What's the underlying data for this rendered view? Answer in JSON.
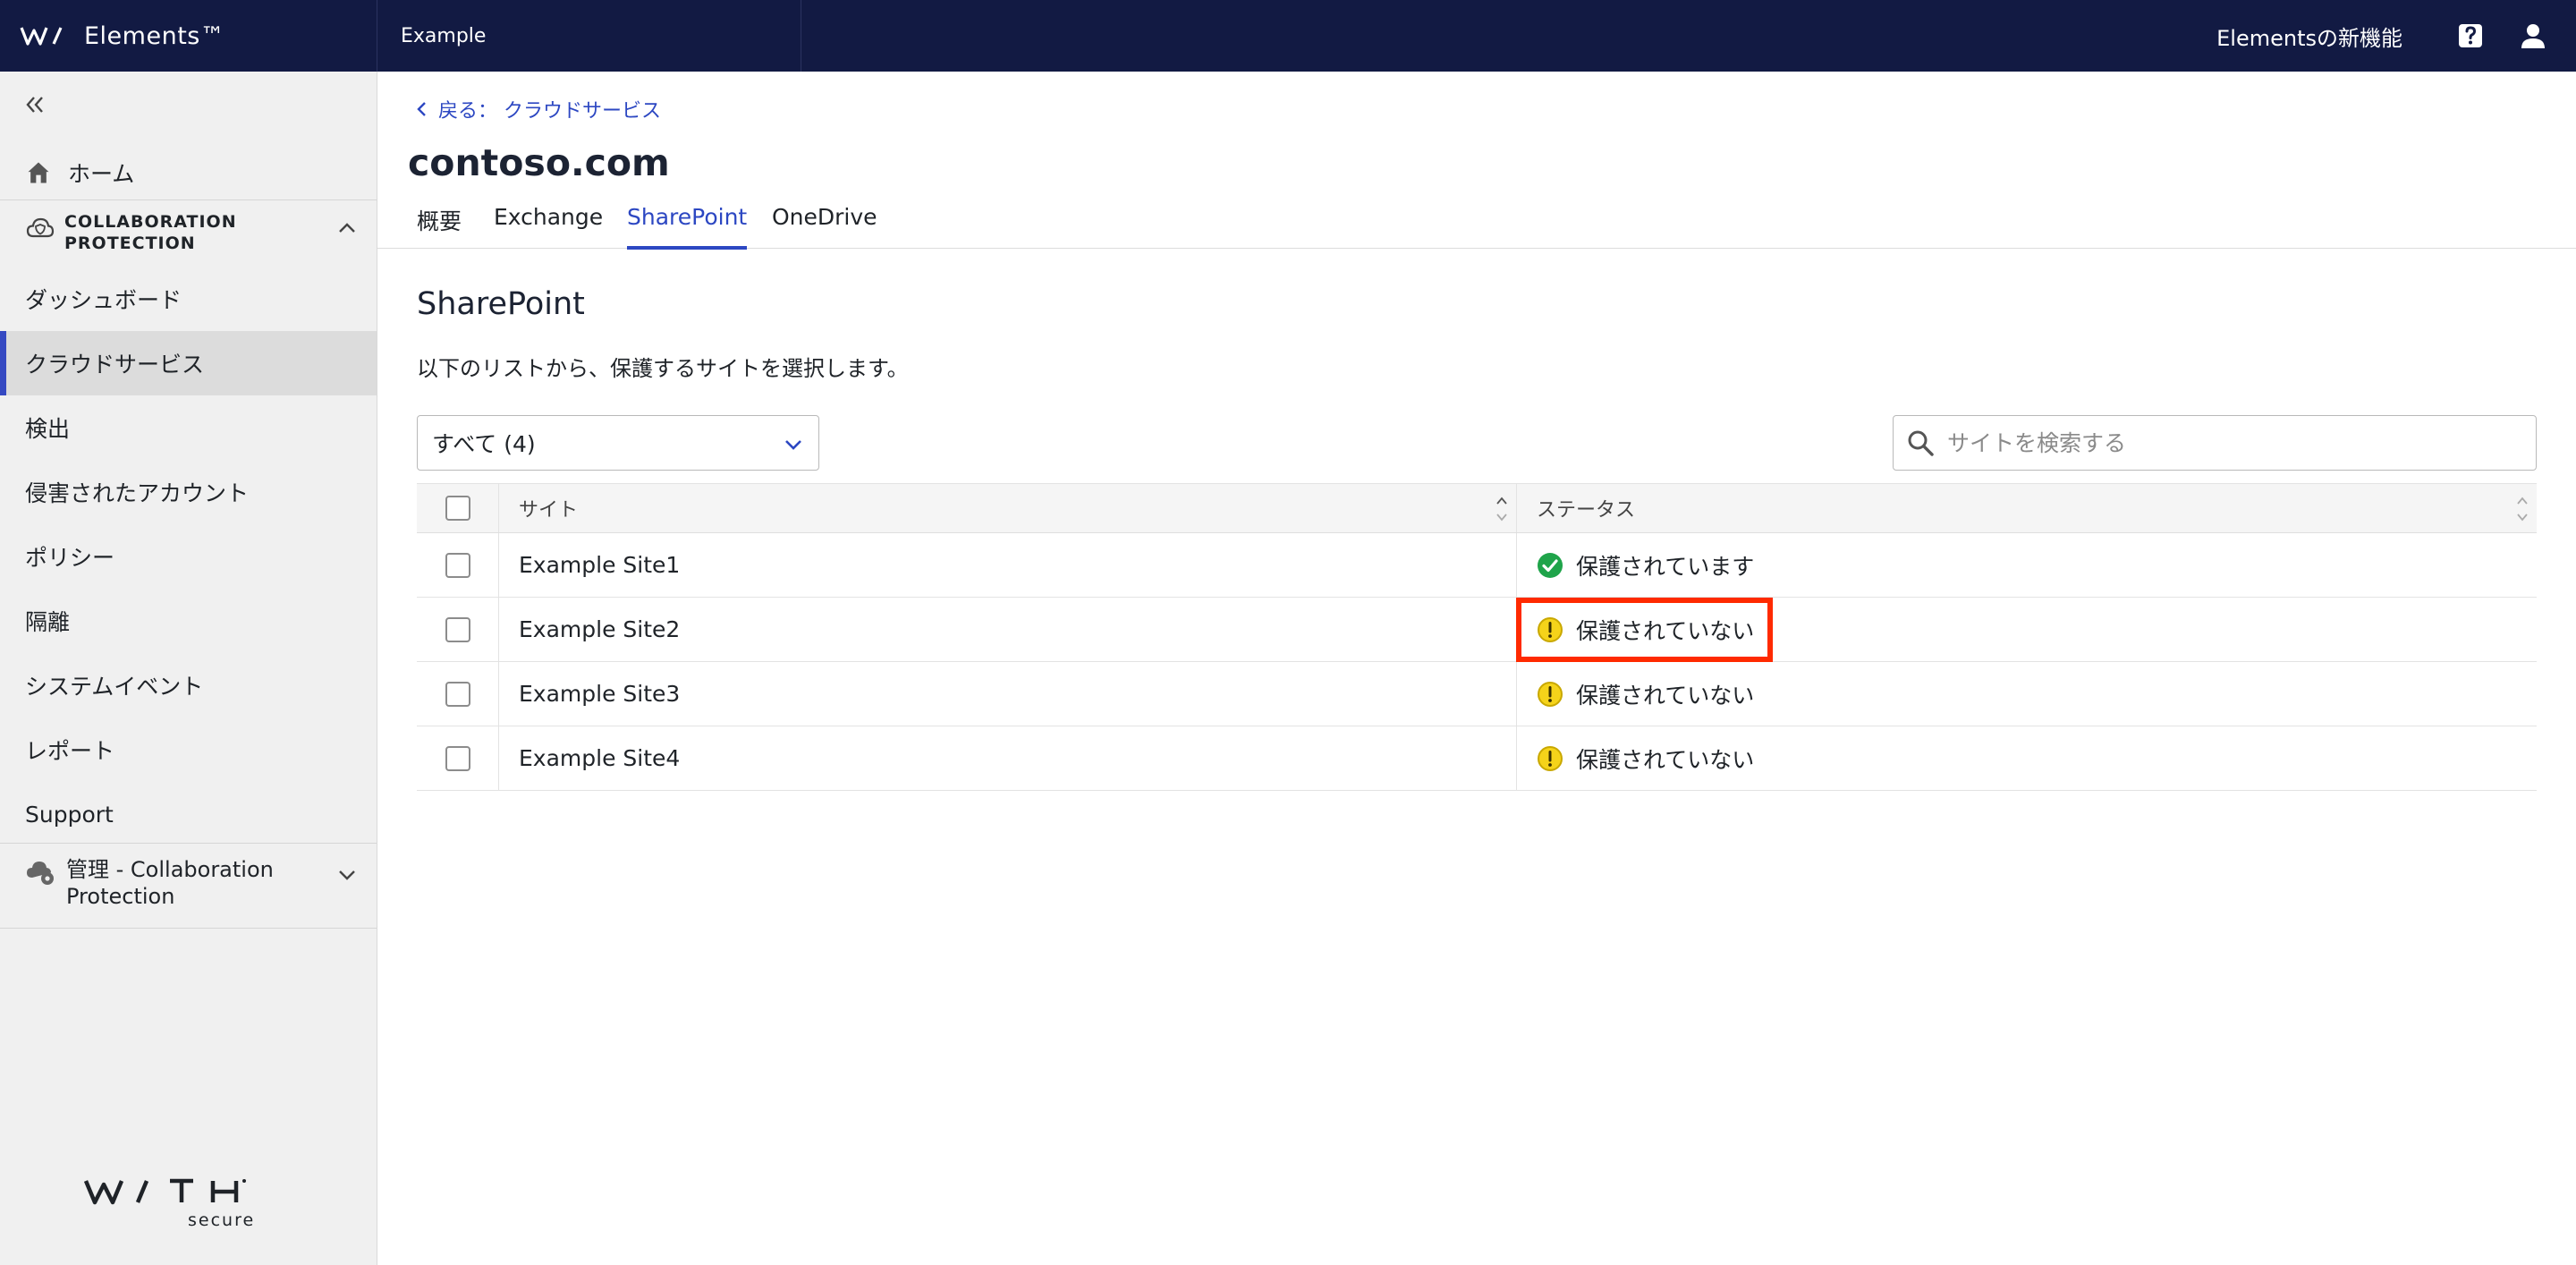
{
  "topbar": {
    "brand_name": "Elements™",
    "organization": "Example",
    "whats_new": "Elementsの新機能"
  },
  "sidebar": {
    "home_label": "ホーム",
    "section_label": "COLLABORATION PROTECTION",
    "items": [
      {
        "label": "ダッシュボード"
      },
      {
        "label": "クラウドサービス"
      },
      {
        "label": "検出"
      },
      {
        "label": "侵害されたアカウント"
      },
      {
        "label": "ポリシー"
      },
      {
        "label": "隔離"
      },
      {
        "label": "システムイベント"
      },
      {
        "label": "レポート"
      },
      {
        "label": "Support"
      }
    ],
    "active_index": 1,
    "admin_section_label": "管理 - Collaboration Protection",
    "footer_logo": "WITH secure"
  },
  "main": {
    "back_link": "戻る： クラウドサービス",
    "title": "contoso.com",
    "tabs": [
      {
        "label": "概要"
      },
      {
        "label": "Exchange"
      },
      {
        "label": "SharePoint"
      },
      {
        "label": "OneDrive"
      }
    ],
    "active_tab": 2,
    "section_title": "SharePoint",
    "section_description": "以下のリストから、保護するサイトを選択します。",
    "filter": {
      "selected": "すべて (4)"
    },
    "search": {
      "placeholder": "サイトを検索する",
      "value": ""
    },
    "table": {
      "columns": {
        "site": "サイト",
        "status": "ステータス"
      },
      "rows": [
        {
          "site": "Example Site1",
          "status": "保護されています",
          "status_type": "protected"
        },
        {
          "site": "Example Site2",
          "status": "保護されていない",
          "status_type": "unprotected"
        },
        {
          "site": "Example Site3",
          "status": "保護されていない",
          "status_type": "unprotected"
        },
        {
          "site": "Example Site4",
          "status": "保護されていない",
          "status_type": "unprotected"
        }
      ]
    }
  },
  "colors": {
    "topbar_bg": "#121a43",
    "accent": "#2c47c2",
    "protected": "#1fa44a",
    "unprotected": "#f5d31a",
    "highlight": "#ff2a00"
  },
  "icons": {
    "protected": "check-circle-icon",
    "unprotected": "warning-circle-icon"
  }
}
